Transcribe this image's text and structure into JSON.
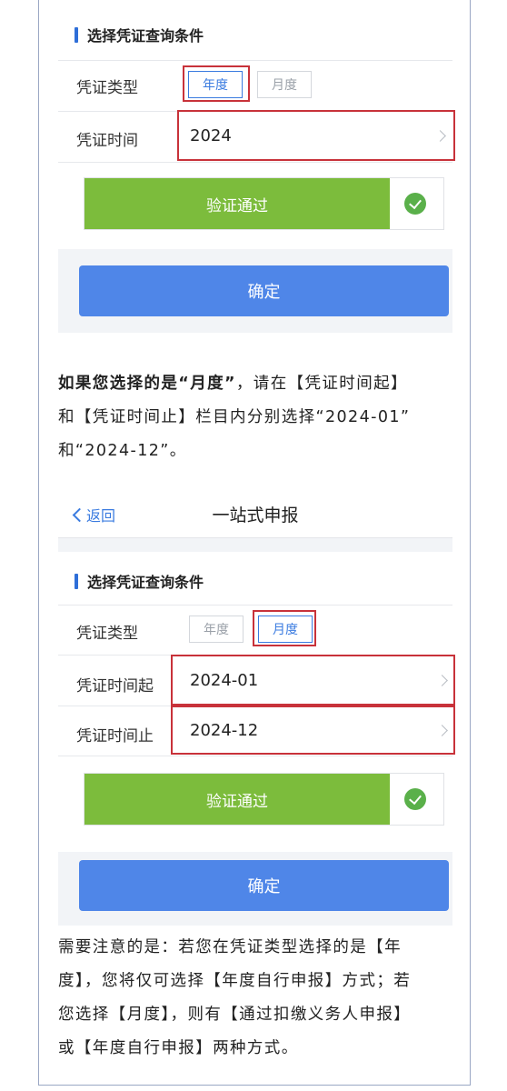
{
  "panel1": {
    "section_title": "选择凭证查询条件",
    "type_label": "凭证类型",
    "toggle_year": "年度",
    "toggle_month": "月度",
    "time_label": "凭证时间",
    "time_value": "2024",
    "verify_label": "验证通过",
    "confirm_label": "确定"
  },
  "instruction": {
    "bold": "如果您选择的是“月度”",
    "line1_rest": "，请在【凭证时间起】",
    "line2": "和【凭证时间止】栏目内分别选择“2024-01”",
    "line3": "和“2024-12”。"
  },
  "panel2": {
    "back_label": "返回",
    "page_title": "一站式申报",
    "section_title": "选择凭证查询条件",
    "type_label": "凭证类型",
    "toggle_year": "年度",
    "toggle_month": "月度",
    "start_label": "凭证时间起",
    "start_value": "2024-01",
    "end_label": "凭证时间止",
    "end_value": "2024-12",
    "verify_label": "验证通过",
    "confirm_label": "确定"
  },
  "note": {
    "line1": "需要注意的是：若您在凭证类型选择的是【年",
    "line2": "度】，您将仅可选择【年度自行申报】方式；若",
    "line3": "您选择【月度】，则有【通过扣缴义务人申报】",
    "line4": "或【年度自行申报】两种方式。"
  },
  "colors": {
    "accent_blue": "#3a7be0",
    "confirm_blue": "#4f86e8",
    "verify_green": "#7cbc3c",
    "highlight_red": "#c8323a"
  }
}
